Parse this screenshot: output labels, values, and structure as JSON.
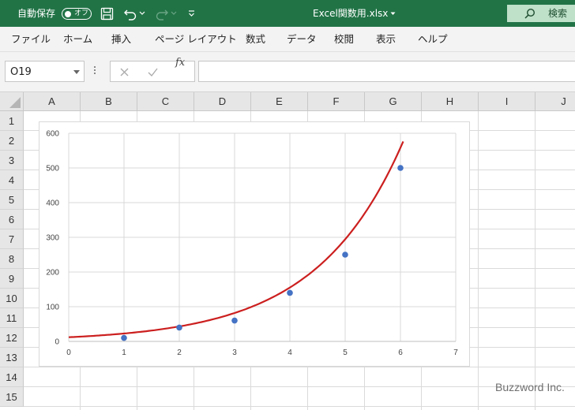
{
  "titlebar": {
    "autosave_label": "自動保存",
    "toggle_state": "オフ",
    "filename": "Excel関数用.xlsx",
    "search_label": "検索"
  },
  "menu": {
    "items": [
      "ファイル",
      "ホーム",
      "挿入",
      "ページ レイアウト",
      "数式",
      "データ",
      "校閲",
      "表示",
      "ヘルプ"
    ]
  },
  "formula_bar": {
    "name_box": "O19",
    "fx_label": "fx",
    "value": ""
  },
  "grid": {
    "columns": [
      "A",
      "B",
      "C",
      "D",
      "E",
      "F",
      "G",
      "H",
      "I",
      "J"
    ],
    "rows": [
      "1",
      "2",
      "3",
      "4",
      "5",
      "6",
      "7",
      "8",
      "9",
      "10",
      "11",
      "12",
      "13",
      "14",
      "15"
    ]
  },
  "chart_data": {
    "type": "scatter",
    "title": "",
    "xlabel": "",
    "ylabel": "",
    "xlim": [
      0,
      7
    ],
    "ylim": [
      0,
      600
    ],
    "x_ticks": [
      "0",
      "1",
      "2",
      "3",
      "4",
      "5",
      "6",
      "7"
    ],
    "y_ticks": [
      "0",
      "100",
      "200",
      "300",
      "400",
      "500",
      "600"
    ],
    "grid": true,
    "legend": "none",
    "series": [
      {
        "x": [
          1,
          2,
          3,
          4,
          5,
          6
        ],
        "y": [
          10,
          40,
          60,
          140,
          250,
          500
        ],
        "color": "#4472c4"
      }
    ],
    "trendline": {
      "type": "curve",
      "color": "#cc1f1f"
    }
  },
  "watermark": "Buzzword Inc."
}
